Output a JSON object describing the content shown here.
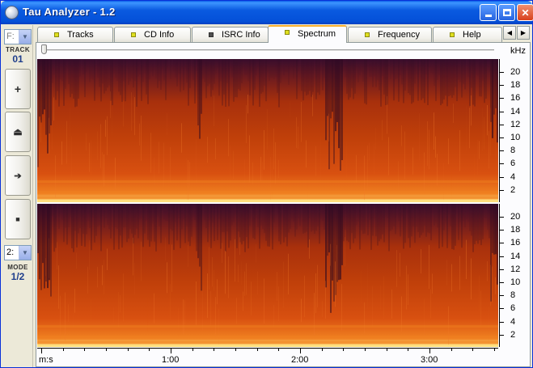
{
  "window": {
    "title": "Tau Analyzer - 1.2"
  },
  "left_panel": {
    "drive_combo_value": "F:",
    "track_label": "TRACK",
    "track_value": "01",
    "buttons": [
      "+",
      "⏏",
      "➔",
      "■"
    ],
    "mode_combo_value": "2:",
    "mode_label": "MODE",
    "mode_value": "1/2"
  },
  "tabs": [
    {
      "label": "Tracks",
      "marker": "yellow"
    },
    {
      "label": "CD Info",
      "marker": "yellow"
    },
    {
      "label": "ISRC Info",
      "marker": "gray"
    },
    {
      "label": "Spectrum",
      "marker": "yellow",
      "active": true
    },
    {
      "label": "Frequency",
      "marker": "yellow"
    },
    {
      "label": "Help",
      "marker": "yellow"
    }
  ],
  "tab_scroll": {
    "left": "◀",
    "right": "▶"
  },
  "spectrum": {
    "unit_label": "kHz",
    "freq_ticks": [
      "20",
      "18",
      "16",
      "14",
      "12",
      "10",
      "8",
      "6",
      "4",
      "2"
    ],
    "time_axis_label": "m:s",
    "time_labels": [
      "1:00",
      "2:00",
      "3:00"
    ],
    "channels": 2,
    "colors": {
      "low_energy": "#3A0E2E",
      "mid_energy": "#C0400A",
      "high_energy": "#F08020",
      "peak": "#FFE080"
    }
  }
}
